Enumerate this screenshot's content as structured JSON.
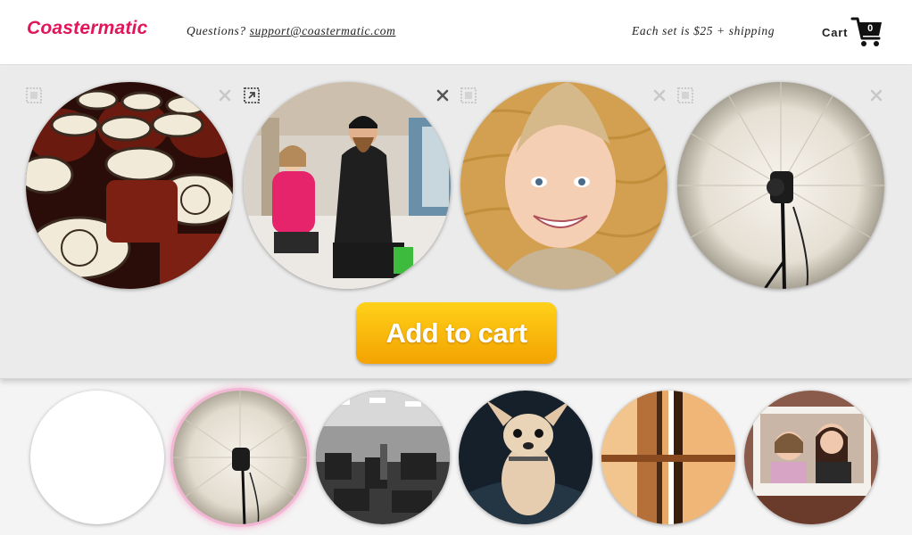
{
  "header": {
    "logo": "Coastermatic",
    "questions_label": "Questions?",
    "support_email": "support@coastermatic.com",
    "price_note": "Each set is $25 + shipping",
    "cart_label": "Cart",
    "cart_count": "0"
  },
  "tray": {
    "slots": [
      {
        "photo": "jars of salsa labels"
      },
      {
        "photo": "man and girl in store"
      },
      {
        "photo": "smiling boy"
      },
      {
        "photo": "studio light umbrella"
      }
    ],
    "add_button_label": "Add to cart"
  },
  "gallery": {
    "thumbs": [
      {
        "photo": "blank",
        "selected": false
      },
      {
        "photo": "studio light umbrella",
        "selected": true
      },
      {
        "photo": "gym interior",
        "selected": false
      },
      {
        "photo": "chihuahua dog",
        "selected": false
      },
      {
        "photo": "curtains window",
        "selected": false
      },
      {
        "photo": "polaroid girls",
        "selected": false
      }
    ]
  },
  "colors": {
    "brand": "#e0155a",
    "button_top": "#ffd11a",
    "button_bottom": "#f3a300",
    "tray_bg": "#ebebeb",
    "selected_glow": "#f3b6d4"
  },
  "icons": [
    "stamp-icon",
    "close-icon",
    "expand-icon",
    "cart-icon"
  ]
}
